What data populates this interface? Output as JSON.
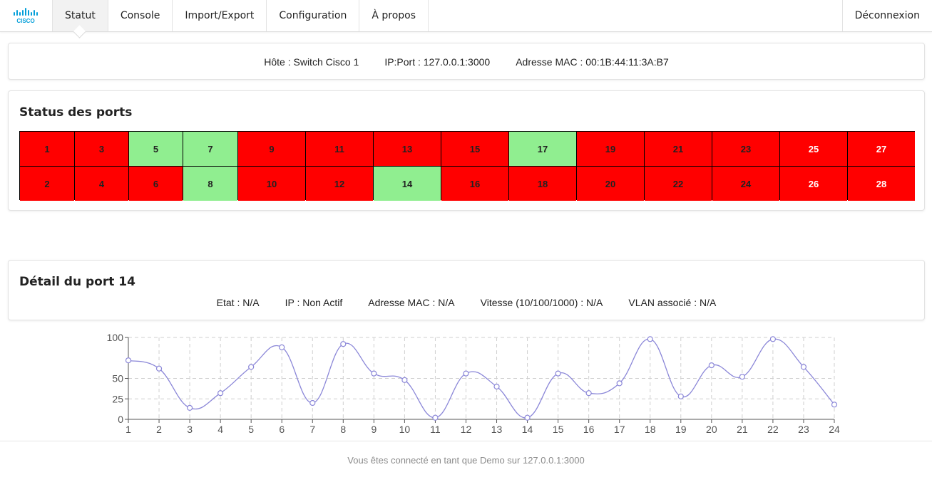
{
  "nav": {
    "tabs": [
      {
        "label": "Statut",
        "active": true
      },
      {
        "label": "Console",
        "active": false
      },
      {
        "label": "Import/Export",
        "active": false
      },
      {
        "label": "Configuration",
        "active": false
      },
      {
        "label": "À propos",
        "active": false
      }
    ],
    "logout_label": "Déconnexion",
    "logo_text": "CISCO",
    "logo_color": "#049fd9"
  },
  "device": {
    "host": "Hôte : Switch Cisco 1",
    "ip_port": "IP:Port : 127.0.0.1:3000",
    "mac": "Adresse MAC : 00:1B:44:11:3A:B7"
  },
  "ports_section": {
    "title": "Status des ports",
    "top_row": [
      {
        "n": "1",
        "up": false
      },
      {
        "n": "3",
        "up": false
      },
      {
        "n": "5",
        "up": true
      },
      {
        "n": "7",
        "up": true
      },
      {
        "n": "9",
        "up": false
      },
      {
        "n": "11",
        "up": false
      },
      {
        "n": "13",
        "up": false
      },
      {
        "n": "15",
        "up": false
      },
      {
        "n": "17",
        "up": true
      },
      {
        "n": "19",
        "up": false
      },
      {
        "n": "21",
        "up": false
      },
      {
        "n": "23",
        "up": false
      },
      {
        "n": "25",
        "up": false
      },
      {
        "n": "27",
        "up": false
      }
    ],
    "bottom_row": [
      {
        "n": "2",
        "up": false
      },
      {
        "n": "4",
        "up": false
      },
      {
        "n": "6",
        "up": false
      },
      {
        "n": "8",
        "up": true
      },
      {
        "n": "10",
        "up": false
      },
      {
        "n": "12",
        "up": false
      },
      {
        "n": "14",
        "up": true
      },
      {
        "n": "16",
        "up": false
      },
      {
        "n": "18",
        "up": false
      },
      {
        "n": "20",
        "up": false
      },
      {
        "n": "22",
        "up": false
      },
      {
        "n": "24",
        "up": false
      },
      {
        "n": "26",
        "up": false
      },
      {
        "n": "28",
        "up": false
      }
    ],
    "colors": {
      "up": "#90ee90",
      "down": "#ff0000"
    }
  },
  "port_detail": {
    "title": "Détail du port 14",
    "etat": "Etat : N/A",
    "ip": "IP : Non Actif",
    "mac": "Adresse MAC : N/A",
    "speed": "Vitesse (10/100/1000) : N/A",
    "vlan": "VLAN associé : N/A"
  },
  "chart_data": {
    "type": "line",
    "x": [
      1,
      2,
      3,
      4,
      5,
      6,
      7,
      8,
      9,
      10,
      11,
      12,
      13,
      14,
      15,
      16,
      17,
      18,
      19,
      20,
      21,
      22,
      23,
      24
    ],
    "series": [
      {
        "values": [
          72,
          62,
          14,
          32,
          64,
          88,
          20,
          92,
          56,
          48,
          2,
          56,
          40,
          2,
          56,
          32,
          44,
          98,
          28,
          66,
          52,
          98,
          64,
          18
        ]
      }
    ],
    "xlim": [
      1,
      24
    ],
    "ylim": [
      0,
      100
    ],
    "yticks": [
      0,
      25,
      50,
      100
    ],
    "grid": true,
    "line_color": "#8b87d8"
  },
  "footer": {
    "text": "Vous êtes connecté en tant que Demo sur 127.0.0.1:3000"
  }
}
